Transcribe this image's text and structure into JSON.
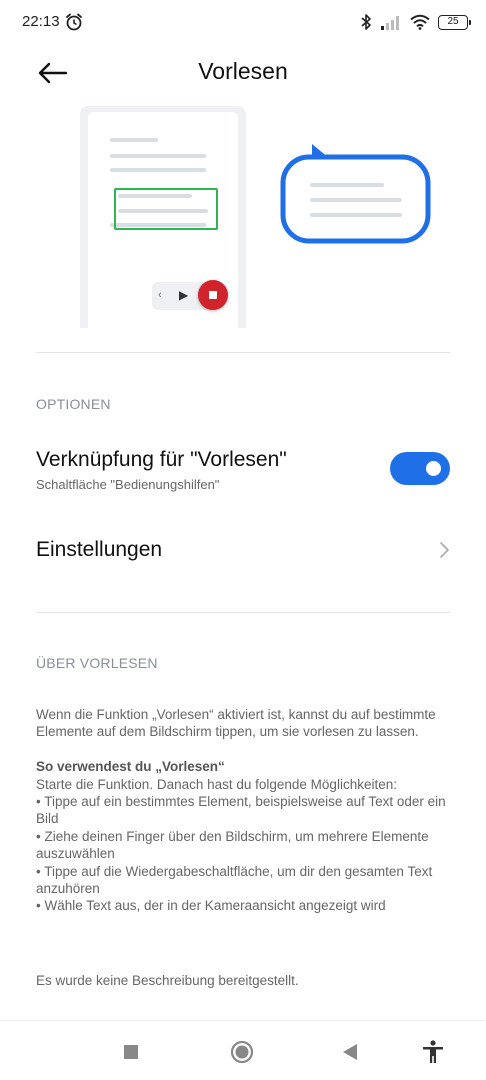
{
  "status_bar": {
    "time": "22:13",
    "battery": "25",
    "icons": [
      "alarm-icon",
      "bluetooth-icon",
      "signal-icon",
      "wifi-icon",
      "battery-icon"
    ]
  },
  "header": {
    "title": "Vorlesen",
    "back_icon": "arrow-left-icon"
  },
  "options": {
    "section_label": "OPTIONEN",
    "shortcut": {
      "title": "Verknüpfung für \"Vorlesen\"",
      "subtitle": "Schaltfläche \"Bedienungshilfen\"",
      "enabled": true
    },
    "settings": {
      "title": "Einstellungen"
    }
  },
  "about": {
    "section_label": "ÜBER VORLESEN",
    "intro": "Wenn die Funktion „Vorlesen“ aktiviert ist, kannst du auf bestimmte Elemente auf dem Bildschirm tippen, um sie vorlesen zu lassen.",
    "howto_title": "So verwendest du „Vorlesen“",
    "howto_lines": [
      "Starte die Funktion. Danach hast du folgende Möglichkeiten:",
      "• Tippe auf ein bestimmtes Element, beispielsweise auf Text oder ein Bild",
      "• Ziehe deinen Finger über den Bildschirm, um mehrere Elemente auszuwählen",
      "• Tippe auf die Wiedergabeschaltfläche, um dir den gesamten Text anzuhören",
      "• Wähle Text aus, der in der Kameraansicht angezeigt wird"
    ],
    "no_description": "Es wurde keine Beschreibung bereitgestellt."
  },
  "colors": {
    "accent": "#1f6fe6",
    "highlight_green": "#2fb551",
    "stop_red": "#d0232b"
  },
  "nav_bar": {
    "icons": [
      "recents-square-icon",
      "home-circle-icon",
      "back-triangle-icon",
      "accessibility-icon"
    ]
  }
}
